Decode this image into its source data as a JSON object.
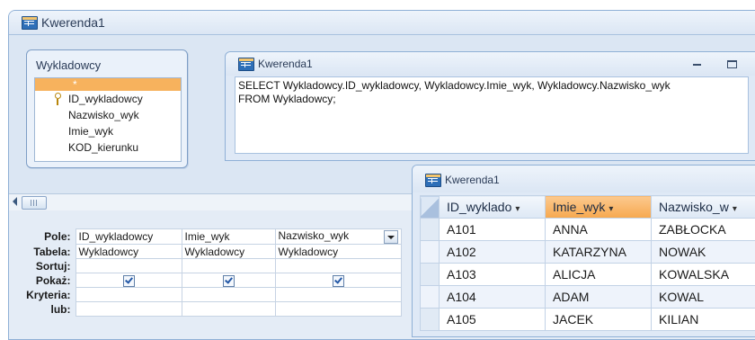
{
  "main_window": {
    "title": "Kwerenda1"
  },
  "table_box": {
    "title": "Wykladowcy",
    "fields": [
      "*",
      "ID_wykladowcy",
      "Nazwisko_wyk",
      "Imie_wyk",
      "KOD_kierunku"
    ]
  },
  "sql_window": {
    "title": "Kwerenda1",
    "text": "SELECT Wykladowcy.ID_wykladowcy, Wykladowcy.Imie_wyk, Wykladowcy.Nazwisko_wyk\nFROM Wykladowcy;"
  },
  "query_grid": {
    "row_labels": {
      "field": "Pole:",
      "table": "Tabela:",
      "sort": "Sortuj:",
      "show": "Pokaż:",
      "criteria": "Kryteria:",
      "or": "lub:"
    },
    "columns": [
      {
        "field": "ID_wykladowcy",
        "table": "Wykladowcy",
        "show": true
      },
      {
        "field": "Imie_wyk",
        "table": "Wykladowcy",
        "show": true
      },
      {
        "field": "Nazwisko_wyk",
        "table": "Wykladowcy",
        "show": true
      }
    ]
  },
  "datasheet": {
    "title": "Kwerenda1",
    "headers": [
      "ID_wyklado",
      "Imie_wyk",
      "Nazwisko_w"
    ],
    "rows": [
      [
        "A101",
        "ANNA",
        "ZABŁOCKA"
      ],
      [
        "A102",
        "KATARZYNA",
        "NOWAK"
      ],
      [
        "A103",
        "ALICJA",
        "KOWALSKA"
      ],
      [
        "A104",
        "ADAM",
        "KOWAL"
      ],
      [
        "A105",
        "JACEK",
        "KILIAN"
      ]
    ]
  },
  "colors": {
    "accent": "#f7b25d",
    "frame": "#8fb0d6",
    "chrome": "#dfe9f6"
  }
}
